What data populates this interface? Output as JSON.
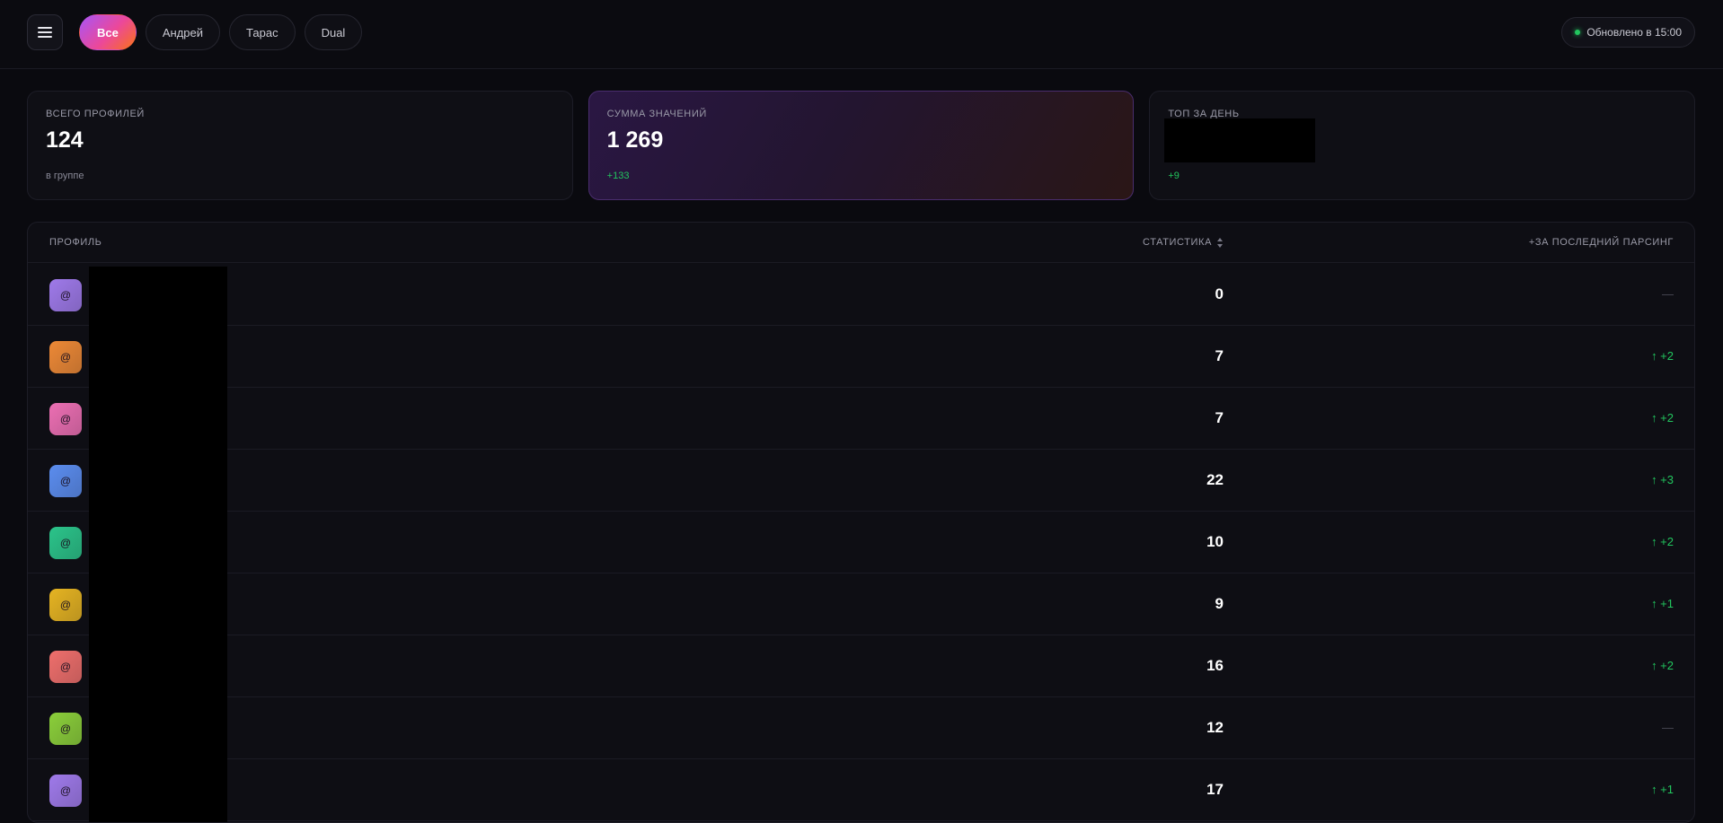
{
  "header": {
    "tabs": [
      {
        "label": "Все",
        "active": true
      },
      {
        "label": "Андрей",
        "active": false
      },
      {
        "label": "Тарас",
        "active": false
      },
      {
        "label": "Dual",
        "active": false
      }
    ],
    "status": "Обновлено в 15:00"
  },
  "cards": [
    {
      "label": "ВСЕГО ПРОФИЛЕЙ",
      "value": "124",
      "sub": "в группе"
    },
    {
      "label": "СУММА ЗНАЧЕНИЙ",
      "value": "1 269",
      "sub": "+133"
    },
    {
      "label": "ТОП ЗА ДЕНЬ",
      "value": "",
      "sub": "+9"
    }
  ],
  "table": {
    "headers": {
      "profile": "ПРОФИЛЬ",
      "stat": "СТАТИСТИКА",
      "delta": "+ЗА ПОСЛЕДНИЙ ПАРСИНГ"
    },
    "rows": [
      {
        "avatar": "@",
        "color": "#9f7aea",
        "stat": "0",
        "delta": "—"
      },
      {
        "avatar": "@",
        "color": "#ed8936",
        "stat": "7",
        "delta": "↑ +2"
      },
      {
        "avatar": "@",
        "color": "#ec6fb3",
        "stat": "7",
        "delta": "↑ +2"
      },
      {
        "avatar": "@",
        "color": "#5b8def",
        "stat": "22",
        "delta": "↑ +3"
      },
      {
        "avatar": "@",
        "color": "#2bc48a",
        "stat": "10",
        "delta": "↑ +2"
      },
      {
        "avatar": "@",
        "color": "#e6b422",
        "stat": "9",
        "delta": "↑ +1"
      },
      {
        "avatar": "@",
        "color": "#ef6f6c",
        "stat": "16",
        "delta": "↑ +2"
      },
      {
        "avatar": "@",
        "color": "#8bcf3a",
        "stat": "12",
        "delta": "—"
      },
      {
        "avatar": "@",
        "color": "#9f7aea",
        "stat": "17",
        "delta": "↑ +1"
      }
    ]
  },
  "colors": {
    "accent_green": "#22c55e",
    "active_tab_gradient": [
      "#a855f7",
      "#ec4899",
      "#f97316"
    ]
  }
}
